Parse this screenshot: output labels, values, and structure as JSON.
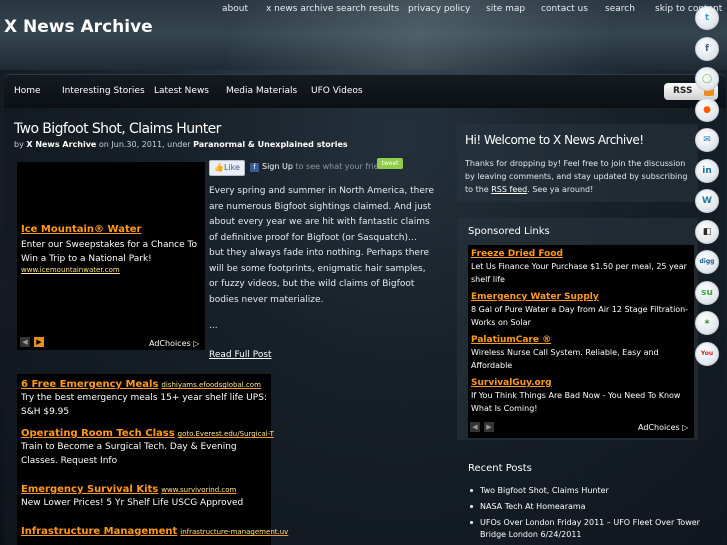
{
  "site": {
    "title": "X News Archive"
  },
  "top_links": [
    "about",
    "x news archive search results",
    "privacy policy",
    "site map",
    "contact us",
    "search",
    "skip to content"
  ],
  "nav": {
    "items": [
      "Home",
      "Interesting Stories",
      "Latest News",
      "Media Materials",
      "UFO Videos"
    ],
    "rss_label": "RSS"
  },
  "post": {
    "title": "Two Bigfoot Shot, Claims Hunter",
    "meta_by": "by",
    "meta_author": "X News Archive",
    "meta_on": "on Jun.30, 2011, under",
    "meta_category": "Paranormal & Unexplained stories",
    "body": "Every spring and summer in North America, there are numerous Bigfoot sightings claimed. And just about every year we are hit with fantastic claims of definitive proof for Bigfoot (or Sasquatch)… but they always fade into nothing. Perhaps there will be some footprints, enigmatic hair samples, or fuzzy videos, but the wild claims of Bigfoot bodies never materialize.",
    "ellipsis": "...",
    "read_more": "Read Full Post",
    "like_label": "Like",
    "signup_label": "Sign Up",
    "signup_suffix": "to see what your friends",
    "tweet_label": "tweet"
  },
  "ad_inline": {
    "heading": "Ice Mountain® Water",
    "text": "Enter our Sweepstakes for a Chance To Win a Trip to a National Park!",
    "url": "www.icemountainwater.com",
    "adchoices": "AdChoices"
  },
  "ad_bottom": [
    {
      "heading": "6 Free Emergency Meals",
      "url": "dishiyams.efoodsglobal.com",
      "text": "Try the best emergency meals 15+ year shelf life UPS: S&H $9.95"
    },
    {
      "heading": "Operating Room Tech Class",
      "url": "goto.Everest.edu/Surgical-T",
      "text": "Train to Become a Surgical Tech. Day & Evening Classes. Request Info"
    },
    {
      "heading": "Emergency Survival Kits",
      "url": "www.survivorind.com",
      "text": "New Lower Prices! 5 Yr Shelf Life USCG Approved"
    },
    {
      "heading": "Infrastructure Management",
      "url": "infrastructure-management.uv",
      "text": ""
    }
  ],
  "welcome": {
    "title": "Hi! Welcome to X News Archive!",
    "text_a": "Thanks for dropping by! Feel free to join the discussion by leaving comments, and stay updated by subscribing to the",
    "link": "RSS feed",
    "text_b": ". See ya around!"
  },
  "sponsored": {
    "title": "Sponsored Links",
    "items": [
      {
        "heading": "Freeze Dried Food",
        "text": "Let Us Finance Your Purchase $1.50 per meal, 25 year shelf life"
      },
      {
        "heading": "Emergency Water Supply",
        "text": "8 Gal of Pure Water a Day from Air 12 Stage Filtration-Works on Solar"
      },
      {
        "heading": "PalatiumCare ®",
        "text": "Wireless Nurse Call System. Reliable, Easy and Affordable"
      },
      {
        "heading": "SurvivalGuy.org",
        "text": "If You Think Things Are Bad Now - You Need To Know What Is Coming!"
      }
    ],
    "adchoices": "AdChoices"
  },
  "recent": {
    "title": "Recent Posts",
    "items": [
      "Two Bigfoot Shot, Claims Hunter",
      "NASA Tech At Homearama",
      "UFOs Over London Friday 2011 – UFO Fleet Over Tower Bridge London 6/24/2011"
    ]
  },
  "social_icons": [
    {
      "name": "twitter-icon",
      "glyph": "t",
      "color": "#3aa3e3"
    },
    {
      "name": "facebook-icon",
      "glyph": "f",
      "color": "#3b5998"
    },
    {
      "name": "chat-icon",
      "glyph": "◯",
      "color": "#58b93c"
    },
    {
      "name": "reddit-icon",
      "glyph": "●",
      "color": "#ff5a00"
    },
    {
      "name": "messenger-icon",
      "glyph": "✉",
      "color": "#1e6fc9"
    },
    {
      "name": "linkedin-icon",
      "glyph": "in",
      "color": "#0e76a8"
    },
    {
      "name": "wordpress-icon",
      "glyph": "W",
      "color": "#21759b"
    },
    {
      "name": "delicious-icon",
      "glyph": "◧",
      "color": "#2a2a2a"
    },
    {
      "name": "digg-icon",
      "glyph": "digg",
      "color": "#1b5891"
    },
    {
      "name": "stumbleupon-icon",
      "glyph": "su",
      "color": "#3ea73e"
    },
    {
      "name": "share-icon",
      "glyph": "✶",
      "color": "#2c8c2c"
    },
    {
      "name": "youtube-icon",
      "glyph": "You",
      "color": "#cc1f1f"
    }
  ]
}
